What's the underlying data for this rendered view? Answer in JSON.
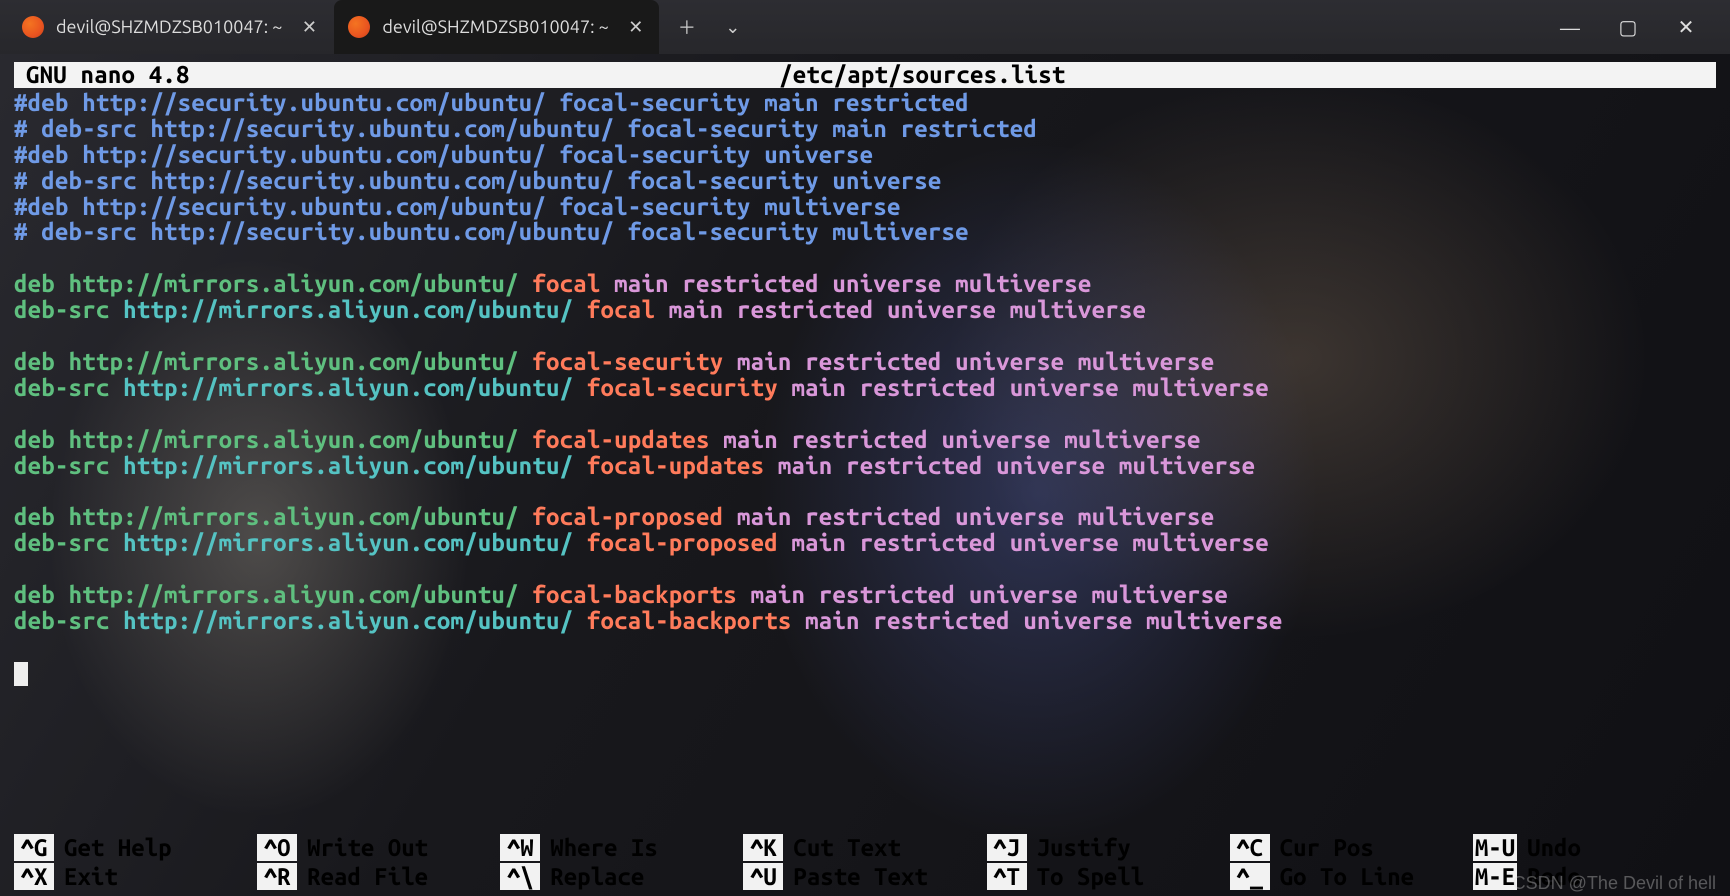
{
  "tabs": [
    {
      "title": "devil@SHZMDZSB010047: ~",
      "active": false
    },
    {
      "title": "devil@SHZMDZSB010047: ~",
      "active": true
    }
  ],
  "editor": {
    "app": "GNU nano 4.8",
    "file": "/etc/apt/sources.list",
    "lines": [
      {
        "t": "c",
        "text": "#deb http://security.ubuntu.com/ubuntu/ focal-security main restricted"
      },
      {
        "t": "c",
        "text": "# deb-src http://security.ubuntu.com/ubuntu/ focal-security main restricted"
      },
      {
        "t": "c",
        "text": "#deb http://security.ubuntu.com/ubuntu/ focal-security universe"
      },
      {
        "t": "c",
        "text": "# deb-src http://security.ubuntu.com/ubuntu/ focal-security universe"
      },
      {
        "t": "c",
        "text": "#deb http://security.ubuntu.com/ubuntu/ focal-security multiverse"
      },
      {
        "t": "c",
        "text": "# deb-src http://security.ubuntu.com/ubuntu/ focal-security multiverse"
      },
      {
        "t": "b"
      },
      {
        "t": "d",
        "key": "deb",
        "url": "http://mirrors.aliyun.com/ubuntu/",
        "dist": "focal",
        "comp": "main restricted universe multiverse"
      },
      {
        "t": "s",
        "key": "deb-src",
        "url": "http://mirrors.aliyun.com/ubuntu/",
        "dist": "focal",
        "comp": "main restricted universe multiverse"
      },
      {
        "t": "b"
      },
      {
        "t": "d",
        "key": "deb",
        "url": "http://mirrors.aliyun.com/ubuntu/",
        "dist": "focal-security",
        "comp": "main restricted universe multiverse"
      },
      {
        "t": "s",
        "key": "deb-src",
        "url": "http://mirrors.aliyun.com/ubuntu/",
        "dist": "focal-security",
        "comp": "main restricted universe multiverse"
      },
      {
        "t": "b"
      },
      {
        "t": "d",
        "key": "deb",
        "url": "http://mirrors.aliyun.com/ubuntu/",
        "dist": "focal-updates",
        "comp": "main restricted universe multiverse"
      },
      {
        "t": "s",
        "key": "deb-src",
        "url": "http://mirrors.aliyun.com/ubuntu/",
        "dist": "focal-updates",
        "comp": "main restricted universe multiverse"
      },
      {
        "t": "b"
      },
      {
        "t": "d",
        "key": "deb",
        "url": "http://mirrors.aliyun.com/ubuntu/",
        "dist": "focal-proposed",
        "comp": "main restricted universe multiverse"
      },
      {
        "t": "s",
        "key": "deb-src",
        "url": "http://mirrors.aliyun.com/ubuntu/",
        "dist": "focal-proposed",
        "comp": "main restricted universe multiverse"
      },
      {
        "t": "b"
      },
      {
        "t": "d",
        "key": "deb",
        "url": "http://mirrors.aliyun.com/ubuntu/",
        "dist": "focal-backports",
        "comp": "main restricted universe multiverse"
      },
      {
        "t": "s",
        "key": "deb-src",
        "url": "http://mirrors.aliyun.com/ubuntu/",
        "dist": "focal-backports",
        "comp": "main restricted universe multiverse"
      },
      {
        "t": "b"
      },
      {
        "t": "cursor"
      }
    ]
  },
  "shortcuts": [
    {
      "key": "^G",
      "label": "Get Help"
    },
    {
      "key": "^O",
      "label": "Write Out"
    },
    {
      "key": "^W",
      "label": "Where Is"
    },
    {
      "key": "^K",
      "label": "Cut Text"
    },
    {
      "key": "^J",
      "label": "Justify"
    },
    {
      "key": "^C",
      "label": "Cur Pos"
    },
    {
      "key": "M-U",
      "label": "Undo"
    },
    {
      "key": "^X",
      "label": "Exit"
    },
    {
      "key": "^R",
      "label": "Read File"
    },
    {
      "key": "^\\",
      "label": "Replace"
    },
    {
      "key": "^U",
      "label": "Paste Text"
    },
    {
      "key": "^T",
      "label": "To Spell"
    },
    {
      "key": "^_",
      "label": "Go To Line"
    },
    {
      "key": "M-E",
      "label": "Redo"
    }
  ],
  "watermark": "CSDN @The Devil of hell"
}
